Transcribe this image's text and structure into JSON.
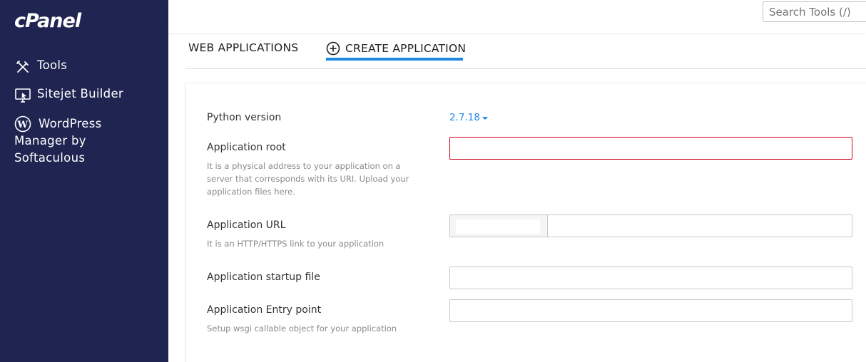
{
  "sidebar": {
    "logo": "cPanel",
    "items": [
      {
        "label": "Tools"
      },
      {
        "label": "Sitejet Builder"
      },
      {
        "label": "WordPress Manager by Softaculous"
      }
    ]
  },
  "topbar": {
    "search_placeholder": "Search Tools (/)"
  },
  "tabs": [
    {
      "label": "WEB APPLICATIONS"
    },
    {
      "label": "CREATE APPLICATION",
      "active": true
    }
  ],
  "form": {
    "python_version": {
      "label": "Python version",
      "value": "2.7.18"
    },
    "app_root": {
      "label": "Application root",
      "help": "It is a physical address to your application on a server that corresponds with its URI. Upload your application files here.",
      "value": ""
    },
    "app_url": {
      "label": "Application URL",
      "help": "It is an HTTP/HTTPS link to your application",
      "value": ""
    },
    "startup_file": {
      "label": "Application startup file",
      "value": ""
    },
    "entry_point": {
      "label": "Application Entry point",
      "help": "Setup wsgi callable object for your application",
      "value": ""
    }
  },
  "colors": {
    "sidebar_bg": "#1f2450",
    "accent": "#1e88e5",
    "error_border": "#d0021b"
  }
}
